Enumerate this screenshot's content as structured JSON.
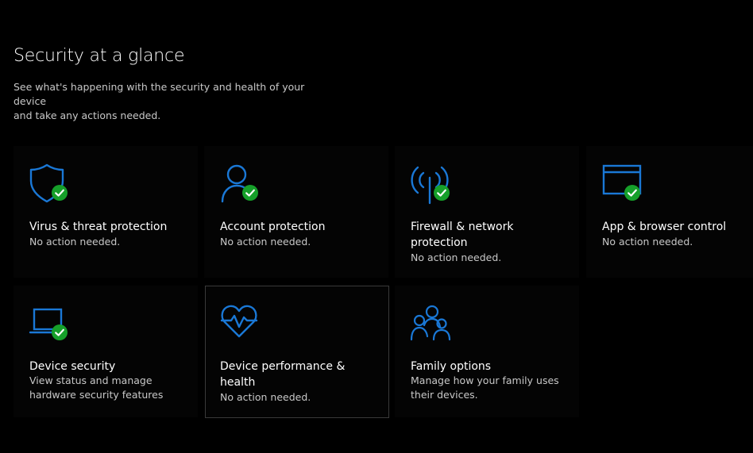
{
  "header": {
    "title": "Security at a glance",
    "description_line1": "See what's happening with the security and health of your device",
    "description_line2": "and take any actions needed."
  },
  "colors": {
    "accent": "#1a78d6",
    "ok_badge": "#16a02a",
    "tile_background": "#040404"
  },
  "tiles": [
    {
      "title_line1": "Virus & threat protection",
      "title_line2": "",
      "status_line1": "No action needed.",
      "status_line2": "",
      "icon": "shield-icon",
      "badge": "check-badge-icon"
    },
    {
      "title_line1": "Account protection",
      "title_line2": "",
      "status_line1": "No action needed.",
      "status_line2": "",
      "icon": "person-icon",
      "badge": "check-badge-icon"
    },
    {
      "title_line1": "Firewall & network",
      "title_line2": "protection",
      "status_line1": "No action needed.",
      "status_line2": "",
      "icon": "antenna-icon",
      "badge": "check-badge-icon"
    },
    {
      "title_line1": "App & browser control",
      "title_line2": "",
      "status_line1": "No action needed.",
      "status_line2": "",
      "icon": "browser-window-icon",
      "badge": "check-badge-icon"
    },
    {
      "title_line1": "Device security",
      "title_line2": "",
      "status_line1": "View status and manage",
      "status_line2": "hardware security features",
      "icon": "laptop-icon",
      "badge": "check-badge-icon"
    },
    {
      "title_line1": "Device performance &",
      "title_line2": "health",
      "status_line1": "No action needed.",
      "status_line2": "",
      "icon": "heart-pulse-icon",
      "badge": ""
    },
    {
      "title_line1": "Family options",
      "title_line2": "",
      "status_line1": "Manage how your family uses",
      "status_line2": "their devices.",
      "icon": "family-icon",
      "badge": ""
    }
  ]
}
